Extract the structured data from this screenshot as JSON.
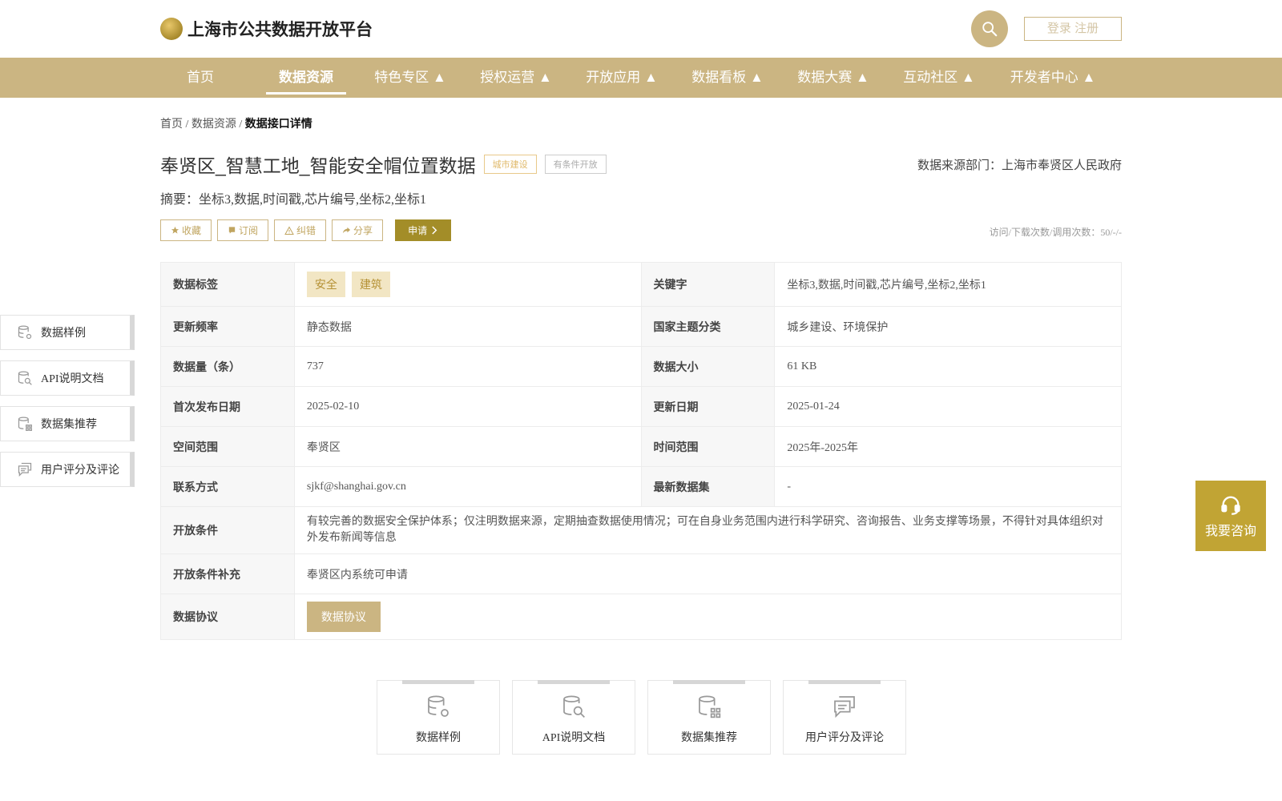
{
  "header": {
    "logo_text": "上海市公共数据开放平台",
    "login_label": "登录 注册"
  },
  "nav": {
    "items": [
      {
        "label": "首页"
      },
      {
        "label": "数据资源"
      },
      {
        "label": "特色专区 ▲"
      },
      {
        "label": "授权运营 ▲"
      },
      {
        "label": "开放应用 ▲"
      },
      {
        "label": "数据看板 ▲"
      },
      {
        "label": "数据大赛 ▲"
      },
      {
        "label": "互动社区 ▲"
      },
      {
        "label": "开发者中心 ▲"
      }
    ]
  },
  "breadcrumb": {
    "home": "首页",
    "sep": "/",
    "section": "数据资源",
    "current": "数据接口详情"
  },
  "dataset": {
    "title": "奉贤区_智慧工地_智能安全帽位置数据",
    "tag_category": "城市建设",
    "tag_open": "有条件开放",
    "source": "数据来源部门：上海市奉贤区人民政府",
    "summary": "摘要：坐标3,数据,时间戳,芯片编号,坐标2,坐标1",
    "visits": "访问/下载次数/调用次数：50/-/-"
  },
  "actions": {
    "favorite": "收藏",
    "subscribe": "订阅",
    "report": "纠错",
    "share": "分享",
    "apply": "申请"
  },
  "table": {
    "tags_label": "数据标签",
    "tags": [
      "安全",
      "建筑"
    ],
    "keywords_label": "关键字",
    "keywords": "坐标3,数据,时间戳,芯片编号,坐标2,坐标1",
    "freq_label": "更新频率",
    "freq": "静态数据",
    "theme_label": "国家主题分类",
    "theme": "城乡建设、环境保护",
    "count_label": "数据量（条）",
    "count": "737",
    "size_label": "数据大小",
    "size": "61 KB",
    "first_pub_label": "首次发布日期",
    "first_pub": "2025-02-10",
    "updated_label": "更新日期",
    "updated": "2025-01-24",
    "space_label": "空间范围",
    "space": "奉贤区",
    "time_label": "时间范围",
    "time": "2025年-2025年",
    "contact_label": "联系方式",
    "contact": "sjkf@shanghai.gov.cn",
    "latest_label": "最新数据集",
    "latest": "-",
    "cond_label": "开放条件",
    "cond": "有较完善的数据安全保护体系；仅注明数据来源，定期抽查数据使用情况；可在自身业务范围内进行科学研究、咨询报告、业务支撑等场景，不得针对具体组织对外发布新闻等信息",
    "cond_extra_label": "开放条件补充",
    "cond_extra": "奉贤区内系统可申请",
    "protocol_label": "数据协议",
    "protocol_btn": "数据协议"
  },
  "side": {
    "items": [
      {
        "label": "数据样例",
        "icon": "database-gear-icon"
      },
      {
        "label": "API说明文档",
        "icon": "document-search-icon"
      },
      {
        "label": "数据集推荐",
        "icon": "database-grid-icon"
      },
      {
        "label": "用户评分及评论",
        "icon": "comment-icon"
      }
    ]
  },
  "consult": {
    "label": "我要咨询"
  },
  "cards": {
    "items": [
      {
        "label": "数据样例"
      },
      {
        "label": "API说明文档"
      },
      {
        "label": "数据集推荐"
      },
      {
        "label": "用户评分及评论"
      }
    ]
  },
  "colors": {
    "primary": "#cbb582",
    "apply": "#a38d28",
    "consult": "#c1a434"
  }
}
